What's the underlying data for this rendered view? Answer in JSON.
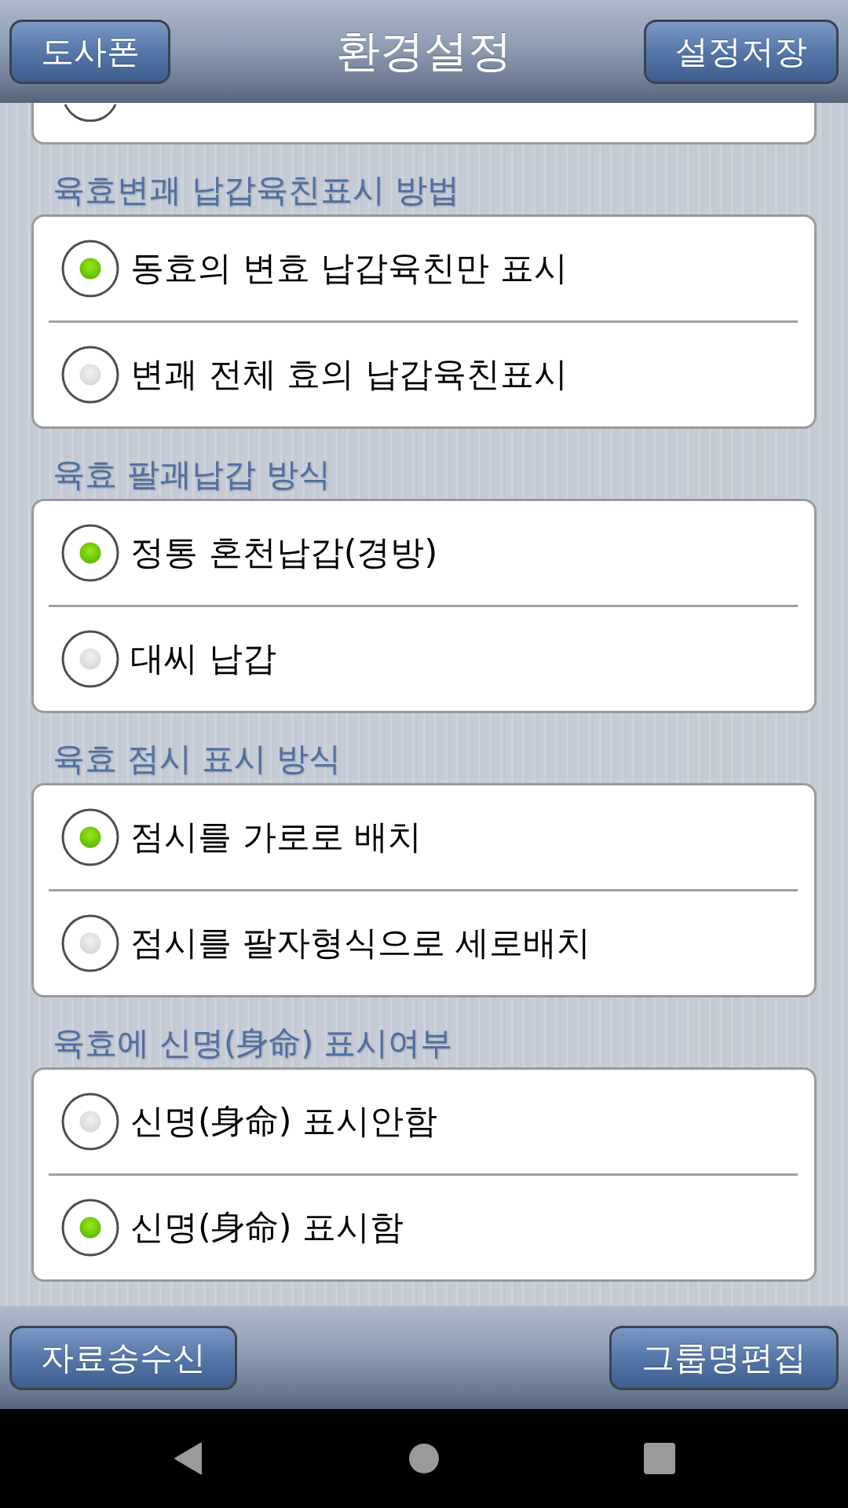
{
  "header": {
    "left_button": "도사폰",
    "title": "환경설정",
    "right_button": "설정저장"
  },
  "sections": [
    {
      "title": "육효변괘 납갑육친표시 방법",
      "options": [
        {
          "label": "동효의 변효 납갑육친만 표시",
          "selected": true
        },
        {
          "label": "변괘 전체 효의 납갑육친표시",
          "selected": false
        }
      ]
    },
    {
      "title": "육효 팔괘납갑 방식",
      "options": [
        {
          "label": "정통 혼천납갑(경방)",
          "selected": true
        },
        {
          "label": "대씨 납갑",
          "selected": false
        }
      ]
    },
    {
      "title": "육효 점시 표시 방식",
      "options": [
        {
          "label": "점시를 가로로 배치",
          "selected": true
        },
        {
          "label": "점시를 팔자형식으로 세로배치",
          "selected": false
        }
      ]
    },
    {
      "title": "육효에 신명(身命) 표시여부",
      "options": [
        {
          "label": "신명(身命) 표시안함",
          "selected": false
        },
        {
          "label": "신명(身命) 표시함",
          "selected": true
        }
      ]
    }
  ],
  "footer": {
    "left_button": "자료송수신",
    "right_button": "그룹명편집"
  }
}
